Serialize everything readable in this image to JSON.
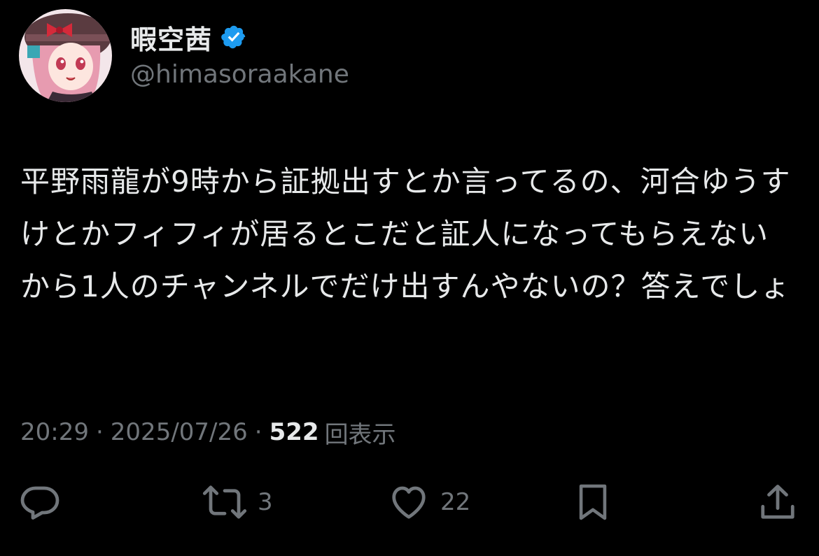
{
  "author": {
    "display_name": "暇空茜",
    "handle": "@himasoraakane",
    "verified_icon": "verified-badge-icon",
    "verified_color": "#1d9bf0"
  },
  "tweet": {
    "text": "平野雨龍が9時から証拠出すとか言ってるの、河合ゆうすけとかフィフィが居るとこだと証人になってもらえないから1人のチャンネルでだけ出すんやないの？答えでしょ"
  },
  "meta": {
    "time": "20:29",
    "separator": "·",
    "date": "2025/07/26",
    "views_count": "522",
    "views_label": "回表示"
  },
  "actions": {
    "reply": {
      "icon": "reply-icon",
      "count": ""
    },
    "retweet": {
      "icon": "retweet-icon",
      "count": "3"
    },
    "like": {
      "icon": "heart-icon",
      "count": "22"
    },
    "bookmark": {
      "icon": "bookmark-icon",
      "count": ""
    },
    "share": {
      "icon": "share-icon",
      "count": ""
    }
  },
  "colors": {
    "background": "#000000",
    "text_primary": "#e7e9ea",
    "text_secondary": "#71767b",
    "accent": "#1d9bf0"
  }
}
